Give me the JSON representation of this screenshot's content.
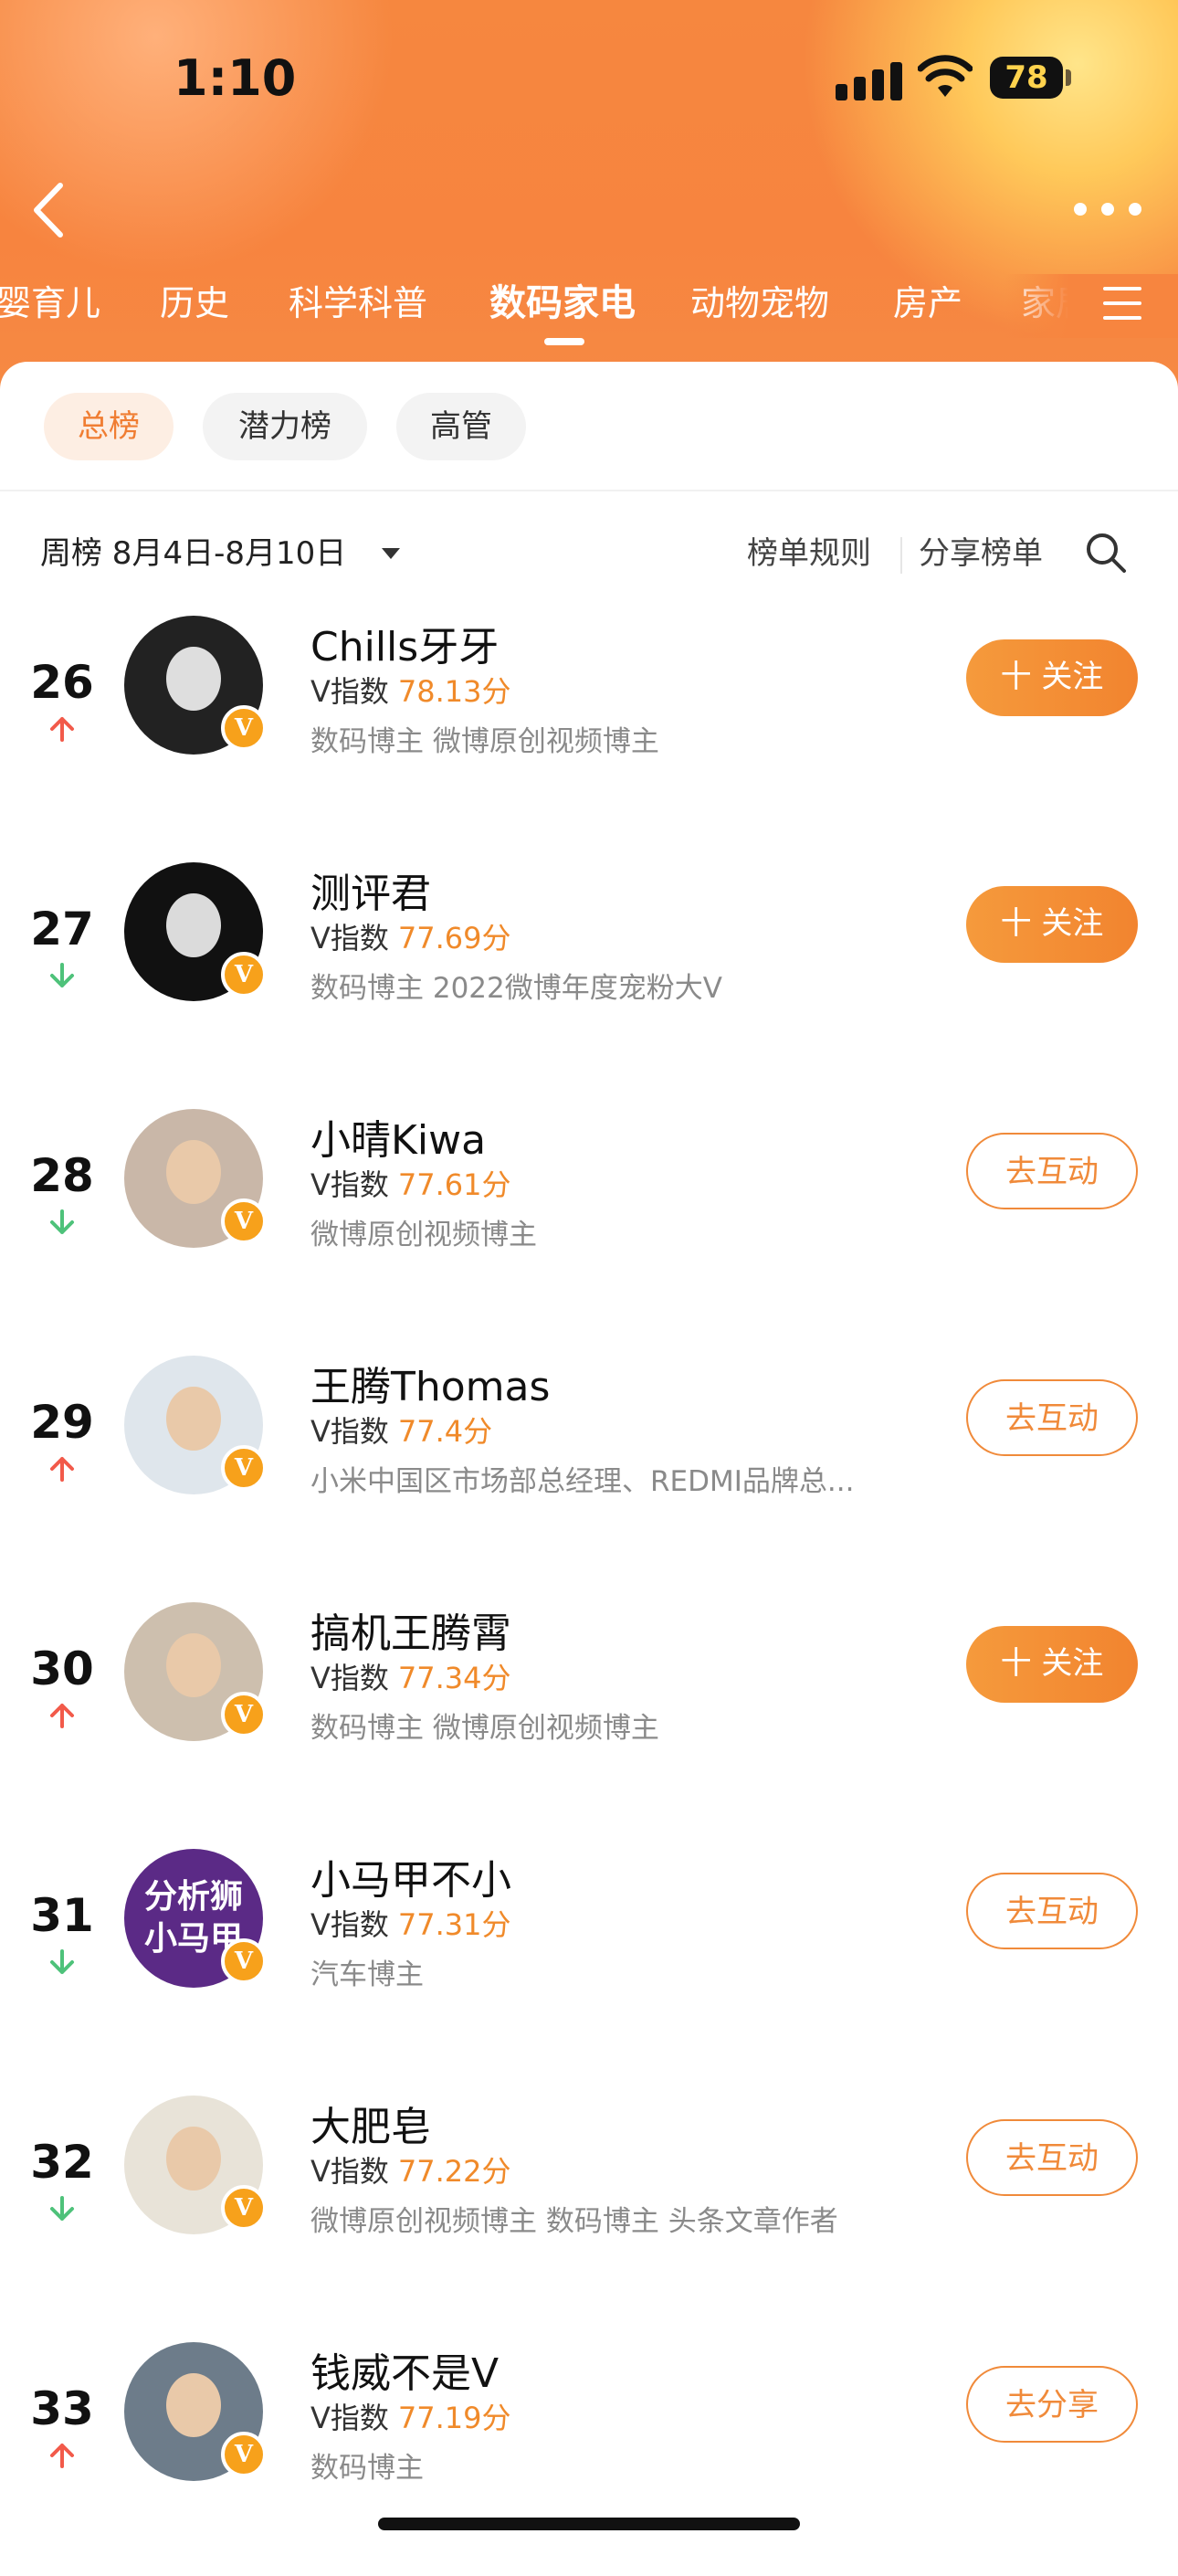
{
  "status_bar": {
    "time": "1:10",
    "battery": "78"
  },
  "category_tabs": [
    "婴育儿",
    "历史",
    "科学科普",
    "数码家电",
    "动物宠物",
    "房产",
    "家居"
  ],
  "active_category": "数码家电",
  "sub_tabs": [
    "总榜",
    "潜力榜",
    "高管"
  ],
  "active_sub_tab": "总榜",
  "period": {
    "label": "周榜 8月4日-8月10日"
  },
  "links": {
    "rules": "榜单规则",
    "share": "分享榜单"
  },
  "colors": {
    "accent": "#f08a2a",
    "header": "#f7853f",
    "up": "#f25a4a",
    "down": "#4ec27a"
  },
  "rankings": [
    {
      "rank": "26",
      "trend": "up",
      "name": "Chills牙牙",
      "v_label": "V指数",
      "score": "78.13分",
      "tags": "数码博主 微博原创视频博主",
      "action": "十 关注",
      "action_type": "follow"
    },
    {
      "rank": "27",
      "trend": "down",
      "name": "测评君",
      "v_label": "V指数",
      "score": "77.69分",
      "tags": "数码博主 2022微博年度宠粉大V",
      "action": "十 关注",
      "action_type": "follow"
    },
    {
      "rank": "28",
      "trend": "down",
      "name": "小晴Kiwa",
      "v_label": "V指数",
      "score": "77.61分",
      "tags": "微博原创视频博主",
      "action": "去互动",
      "action_type": "outline"
    },
    {
      "rank": "29",
      "trend": "up",
      "name": "王腾Thomas",
      "v_label": "V指数",
      "score": "77.4分",
      "tags": "小米中国区市场部总经理、REDMI品牌总...",
      "action": "去互动",
      "action_type": "outline"
    },
    {
      "rank": "30",
      "trend": "up",
      "name": "搞机王腾霄",
      "v_label": "V指数",
      "score": "77.34分",
      "tags": "数码博主 微博原创视频博主",
      "action": "十 关注",
      "action_type": "follow"
    },
    {
      "rank": "31",
      "trend": "down",
      "name": "小马甲不小",
      "v_label": "V指数",
      "score": "77.31分",
      "tags": "汽车博主",
      "action": "去互动",
      "action_type": "outline",
      "avatar_text": [
        "分析狮",
        "小马甲"
      ]
    },
    {
      "rank": "32",
      "trend": "down",
      "name": "大肥皂",
      "v_label": "V指数",
      "score": "77.22分",
      "tags": "微博原创视频博主 数码博主 头条文章作者",
      "action": "去互动",
      "action_type": "outline"
    },
    {
      "rank": "33",
      "trend": "up",
      "name": "钱威不是V",
      "v_label": "V指数",
      "score": "77.19分",
      "tags": "数码博主",
      "action": "去分享",
      "action_type": "outline"
    }
  ]
}
